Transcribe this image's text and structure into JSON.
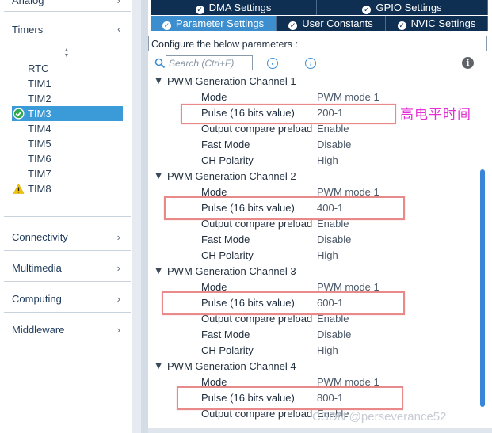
{
  "left_panel": {
    "categories_top": [
      {
        "label": "Analog"
      },
      {
        "label": "Timers"
      }
    ],
    "timers": [
      {
        "label": "RTC",
        "status": "none"
      },
      {
        "label": "TIM1",
        "status": "none"
      },
      {
        "label": "TIM2",
        "status": "none"
      },
      {
        "label": "TIM3",
        "status": "ok"
      },
      {
        "label": "TIM4",
        "status": "none"
      },
      {
        "label": "TIM5",
        "status": "none"
      },
      {
        "label": "TIM6",
        "status": "none"
      },
      {
        "label": "TIM7",
        "status": "none"
      },
      {
        "label": "TIM8",
        "status": "warning"
      }
    ],
    "categories_bottom": [
      {
        "label": "Connectivity"
      },
      {
        "label": "Multimedia"
      },
      {
        "label": "Computing"
      },
      {
        "label": "Middleware"
      }
    ],
    "selected_timer": "TIM3",
    "chevron_glyph": "›",
    "sort_glyph": "▲▼"
  },
  "tabs": {
    "row1": [
      {
        "label": "DMA Settings"
      },
      {
        "label": "GPIO Settings"
      }
    ],
    "row2": [
      {
        "label": "Parameter Settings",
        "active": true
      },
      {
        "label": "User Constants",
        "active": false
      },
      {
        "label": "NVIC Settings",
        "active": false
      }
    ],
    "check_glyph": "✓"
  },
  "config_bar": {
    "text": "Configure the below parameters :"
  },
  "search": {
    "placeholder": "Search (Ctrl+F)",
    "prev_glyph": "‹",
    "next_glyph": "›",
    "info_glyph": "i"
  },
  "groups": [
    {
      "title": "PWM Generation Channel 1",
      "params": [
        {
          "name": "Mode",
          "value": "PWM mode 1"
        },
        {
          "name": "Pulse (16 bits value)",
          "value": "200-1"
        },
        {
          "name": "Output compare preload",
          "value": "Enable"
        },
        {
          "name": "Fast Mode",
          "value": "Disable"
        },
        {
          "name": "CH Polarity",
          "value": "High"
        }
      ]
    },
    {
      "title": "PWM Generation Channel 2",
      "params": [
        {
          "name": "Mode",
          "value": "PWM mode 1"
        },
        {
          "name": "Pulse (16 bits value)",
          "value": "400-1"
        },
        {
          "name": "Output compare preload",
          "value": "Enable"
        },
        {
          "name": "Fast Mode",
          "value": "Disable"
        },
        {
          "name": "CH Polarity",
          "value": "High"
        }
      ]
    },
    {
      "title": "PWM Generation Channel 3",
      "params": [
        {
          "name": "Mode",
          "value": "PWM mode 1"
        },
        {
          "name": "Pulse (16 bits value)",
          "value": "600-1"
        },
        {
          "name": "Output compare preload",
          "value": "Enable"
        },
        {
          "name": "Fast Mode",
          "value": "Disable"
        },
        {
          "name": "CH Polarity",
          "value": "High"
        }
      ]
    },
    {
      "title": "PWM Generation Channel 4",
      "params": [
        {
          "name": "Mode",
          "value": "PWM mode 1"
        },
        {
          "name": "Pulse (16 bits value)",
          "value": "800-1"
        },
        {
          "name": "Output compare preload",
          "value": "Enable"
        }
      ]
    }
  ],
  "group_glyph": "▶",
  "annotation": {
    "text": "高电平时间"
  },
  "watermark": {
    "text": "CSDN @perseverance52"
  },
  "colors": {
    "accent": "#3d8ecf",
    "tab_dark": "#0e2e52",
    "highlight": "#e88a8a",
    "annotation": "#e32fd4",
    "selected": "#3b9bd8"
  }
}
